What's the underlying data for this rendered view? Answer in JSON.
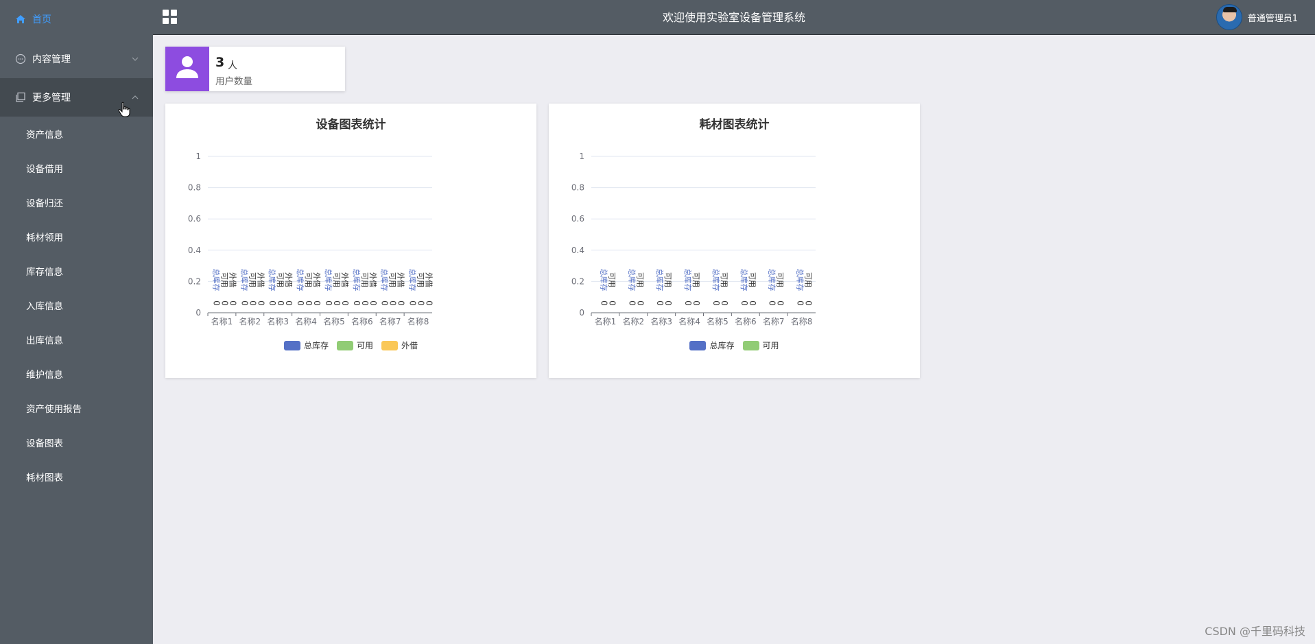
{
  "header": {
    "title": "欢迎使用实验室设备管理系统",
    "user_name": "普通管理员1"
  },
  "sidebar": {
    "home": "首页",
    "content": "内容管理",
    "more": "更多管理",
    "sub_items": [
      "资产信息",
      "设备借用",
      "设备归还",
      "耗材领用",
      "库存信息",
      "入库信息",
      "出库信息",
      "维护信息",
      "资产使用报告",
      "设备图表",
      "耗材图表"
    ]
  },
  "stat": {
    "value": "3",
    "unit": "人",
    "label": "用户数量"
  },
  "colors": {
    "total": "#5470c6",
    "available": "#91cc75",
    "lent": "#fac858",
    "stat_icon": "#8d4ce0"
  },
  "chart_data": [
    {
      "type": "bar",
      "title": "设备图表统计",
      "categories": [
        "名称1",
        "名称2",
        "名称3",
        "名称4",
        "名称5",
        "名称6",
        "名称7",
        "名称8"
      ],
      "yticks": [
        "0",
        "0.2",
        "0.4",
        "0.6",
        "0.8",
        "1"
      ],
      "ylim": [
        0,
        1
      ],
      "series": [
        {
          "name": "总库存",
          "values": [
            0,
            0,
            0,
            0,
            0,
            0,
            0,
            0
          ]
        },
        {
          "name": "可用",
          "values": [
            0,
            0,
            0,
            0,
            0,
            0,
            0,
            0
          ]
        },
        {
          "name": "外借",
          "values": [
            0,
            0,
            0,
            0,
            0,
            0,
            0,
            0
          ]
        }
      ],
      "legend": "bottom"
    },
    {
      "type": "bar",
      "title": "耗材图表统计",
      "categories": [
        "名称1",
        "名称2",
        "名称3",
        "名称4",
        "名称5",
        "名称6",
        "名称7",
        "名称8"
      ],
      "yticks": [
        "0",
        "0.2",
        "0.4",
        "0.6",
        "0.8",
        "1"
      ],
      "ylim": [
        0,
        1
      ],
      "series": [
        {
          "name": "总库存",
          "values": [
            0,
            0,
            0,
            0,
            0,
            0,
            0,
            0
          ]
        },
        {
          "name": "可用",
          "values": [
            0,
            0,
            0,
            0,
            0,
            0,
            0,
            0
          ]
        }
      ],
      "legend": "bottom"
    }
  ],
  "watermark": "CSDN @千里码科技"
}
